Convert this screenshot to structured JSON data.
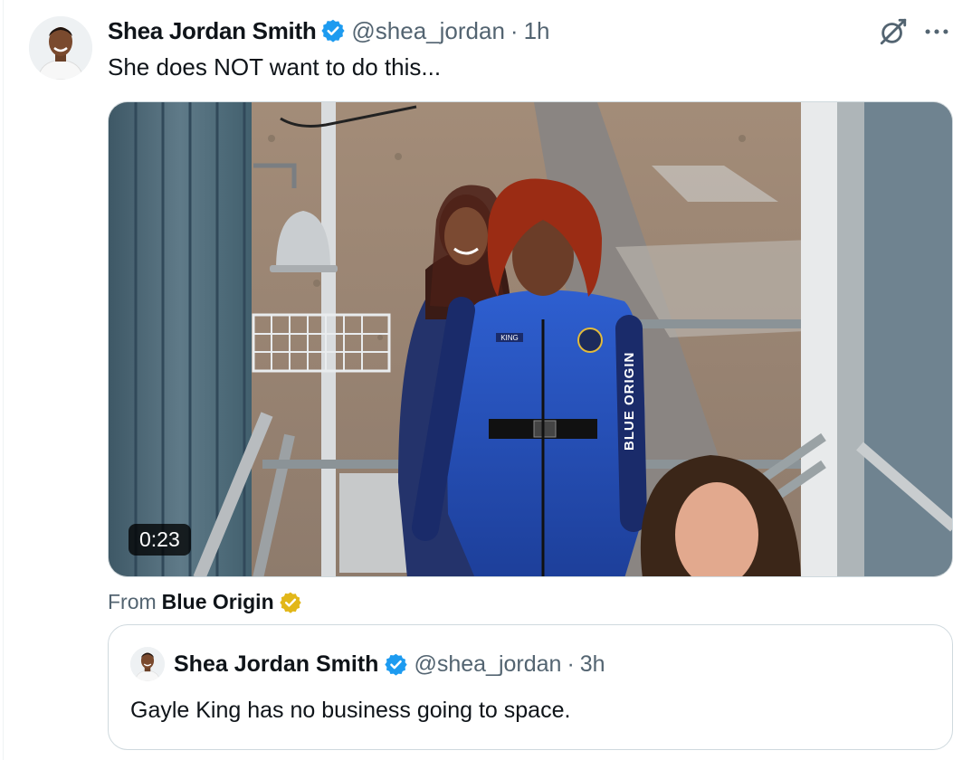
{
  "tweet": {
    "author": "Shea Jordan Smith",
    "handle": "@shea_jordan",
    "separator": "·",
    "time": "1h",
    "text": "She does NOT want to do this...",
    "icons": [
      "grok-icon",
      "more-icon",
      "verified-badge-icon"
    ]
  },
  "media": {
    "type": "video",
    "duration": "0:23",
    "suit_label": "BLUE ORIGIN",
    "name_patch": "KING"
  },
  "from": {
    "prefix": "From",
    "source": "Blue Origin",
    "badge": "gold-verified-badge"
  },
  "quote": {
    "author": "Shea Jordan Smith",
    "handle": "@shea_jordan",
    "separator": "·",
    "time": "3h",
    "text": "Gayle King has no business going to space."
  },
  "colors": {
    "verified_blue": "#1d9bf0",
    "gold_badge": "#e2b719",
    "secondary_text": "#536471",
    "border": "#cfd9de"
  }
}
